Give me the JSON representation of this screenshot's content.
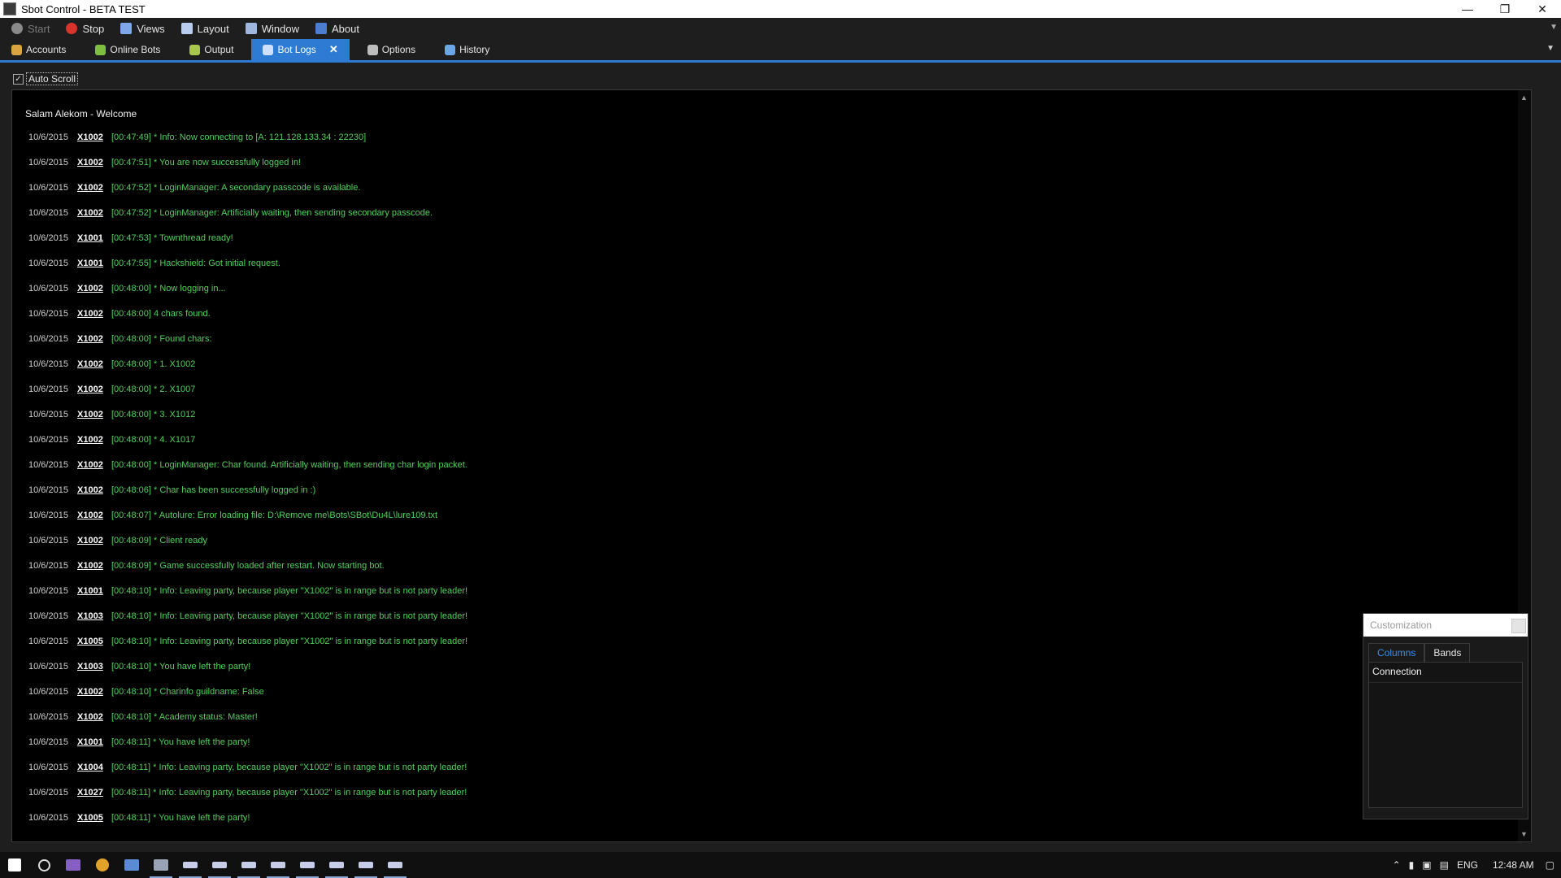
{
  "window": {
    "title": "Sbot Control - BETA TEST"
  },
  "menu": {
    "items": [
      {
        "label": "Start",
        "icon": "start-icon",
        "color": "#8a8a8a",
        "enabled": false
      },
      {
        "label": "Stop",
        "icon": "stop-icon",
        "color": "#d9342b",
        "enabled": true
      },
      {
        "label": "Views",
        "icon": "views-icon",
        "color": "#7da7e8",
        "enabled": true
      },
      {
        "label": "Layout",
        "icon": "layout-icon",
        "color": "#b9cdee",
        "enabled": true
      },
      {
        "label": "Window",
        "icon": "window-icon",
        "color": "#9fb6df",
        "enabled": true
      },
      {
        "label": "About",
        "icon": "about-icon",
        "color": "#4a7fd0",
        "enabled": true
      }
    ]
  },
  "tabs": [
    {
      "label": "Accounts",
      "icon": "accounts-icon",
      "color": "#d9a441",
      "active": false
    },
    {
      "label": "Online Bots",
      "icon": "online-bots-icon",
      "color": "#7fbf3f",
      "active": false
    },
    {
      "label": "Output",
      "icon": "output-icon",
      "color": "#a8c64a",
      "active": false
    },
    {
      "label": "Bot Logs",
      "icon": "bot-logs-icon",
      "color": "#cfe0ff",
      "active": true
    },
    {
      "label": "Options",
      "icon": "options-icon",
      "color": "#bdbdbd",
      "active": false
    },
    {
      "label": "History",
      "icon": "history-icon",
      "color": "#6aa6e8",
      "active": false
    }
  ],
  "auto_scroll": {
    "label": "Auto Scroll",
    "checked": true
  },
  "log": {
    "welcome": "Salam Alekom - Welcome",
    "rows": [
      {
        "date": "10/6/2015",
        "bot": "X1002",
        "msg": "[00:47:49] * Info: Now connecting to [A: 121.128.133.34 : 22230]"
      },
      {
        "date": "10/6/2015",
        "bot": "X1002",
        "msg": "[00:47:51] * You are now successfully logged in!"
      },
      {
        "date": "10/6/2015",
        "bot": "X1002",
        "msg": "[00:47:52] * LoginManager: A secondary passcode is available."
      },
      {
        "date": "10/6/2015",
        "bot": "X1002",
        "msg": "[00:47:52] * LoginManager: Artificially waiting, then sending secondary passcode."
      },
      {
        "date": "10/6/2015",
        "bot": "X1001",
        "msg": "[00:47:53] * Townthread ready!"
      },
      {
        "date": "10/6/2015",
        "bot": "X1001",
        "msg": "[00:47:55] * Hackshield: Got initial request."
      },
      {
        "date": "10/6/2015",
        "bot": "X1002",
        "msg": "[00:48:00] * Now logging in..."
      },
      {
        "date": "10/6/2015",
        "bot": "X1002",
        "msg": "[00:48:00] 4 chars found."
      },
      {
        "date": "10/6/2015",
        "bot": "X1002",
        "msg": "[00:48:00] * Found chars:"
      },
      {
        "date": "10/6/2015",
        "bot": "X1002",
        "msg": "[00:48:00] * 1. X1002"
      },
      {
        "date": "10/6/2015",
        "bot": "X1002",
        "msg": "[00:48:00] * 2. X1007"
      },
      {
        "date": "10/6/2015",
        "bot": "X1002",
        "msg": "[00:48:00] * 3. X1012"
      },
      {
        "date": "10/6/2015",
        "bot": "X1002",
        "msg": "[00:48:00] * 4. X1017"
      },
      {
        "date": "10/6/2015",
        "bot": "X1002",
        "msg": "[00:48:00] * LoginManager: Char found. Artificially waiting, then sending char login packet."
      },
      {
        "date": "10/6/2015",
        "bot": "X1002",
        "msg": "[00:48:06] * Char has been successfully logged in :)"
      },
      {
        "date": "10/6/2015",
        "bot": "X1002",
        "msg": "[00:48:07] * Autolure: Error loading file: D:\\Remove me\\Bots\\SBot\\Du4L\\lure109.txt"
      },
      {
        "date": "10/6/2015",
        "bot": "X1002",
        "msg": "[00:48:09] * Client ready"
      },
      {
        "date": "10/6/2015",
        "bot": "X1002",
        "msg": "[00:48:09] * Game successfully loaded after restart. Now starting bot."
      },
      {
        "date": "10/6/2015",
        "bot": "X1001",
        "msg": "[00:48:10] * Info: Leaving party, because player \"X1002\" is in range but is not party leader!"
      },
      {
        "date": "10/6/2015",
        "bot": "X1003",
        "msg": "[00:48:10] * Info: Leaving party, because player \"X1002\" is in range but is not party leader!"
      },
      {
        "date": "10/6/2015",
        "bot": "X1005",
        "msg": "[00:48:10] * Info: Leaving party, because player \"X1002\" is in range but is not party leader!"
      },
      {
        "date": "10/6/2015",
        "bot": "X1003",
        "msg": "[00:48:10] * You have left the party!"
      },
      {
        "date": "10/6/2015",
        "bot": "X1002",
        "msg": "[00:48:10] * Charinfo guildname: False"
      },
      {
        "date": "10/6/2015",
        "bot": "X1002",
        "msg": "[00:48:10] * Academy status: Master!"
      },
      {
        "date": "10/6/2015",
        "bot": "X1001",
        "msg": "[00:48:11] * You have left the party!"
      },
      {
        "date": "10/6/2015",
        "bot": "X1004",
        "msg": "[00:48:11] * Info: Leaving party, because player \"X1002\" is in range but is not party leader!"
      },
      {
        "date": "10/6/2015",
        "bot": "X1027",
        "msg": "[00:48:11] * Info: Leaving party, because player \"X1002\" is in range but is not party leader!"
      },
      {
        "date": "10/6/2015",
        "bot": "X1005",
        "msg": "[00:48:11] * You have left the party!"
      }
    ]
  },
  "customization": {
    "title": "Customization",
    "tabs": [
      "Columns",
      "Bands"
    ],
    "active_tab": "Columns",
    "items": [
      "Connection"
    ]
  },
  "taskbar": {
    "icons": [
      "windows-start-icon",
      "search-icon",
      "visual-studio-icon",
      "chrome-icon",
      "app-icon",
      "sbot-icon",
      "sbot-window-1-icon",
      "sbot-window-2-icon",
      "sbot-window-3-icon",
      "sbot-window-4-icon",
      "sbot-window-5-icon",
      "sbot-window-6-icon",
      "sbot-window-7-icon",
      "sbot-window-8-icon"
    ],
    "language": "ENG",
    "clock": "12:48 AM"
  },
  "colors": {
    "accent": "#2e7bd4",
    "log_text": "#4fd15a",
    "log_bg": "#000000"
  }
}
